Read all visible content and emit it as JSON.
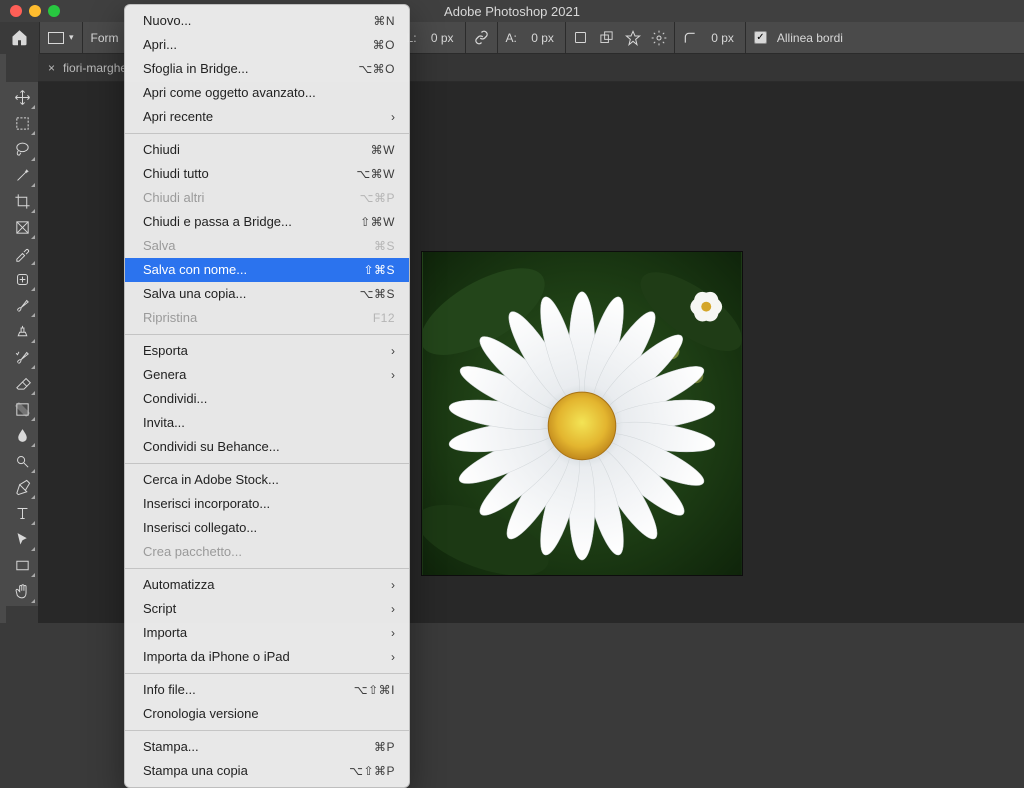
{
  "window": {
    "title": "Adobe Photoshop 2021"
  },
  "optionsbar": {
    "shape_tool": "rectangle",
    "form_label": "Form",
    "width_label": "L:",
    "width_value": "0 px",
    "height_label": "A:",
    "height_value": "0 px",
    "radius_value": "0 px",
    "align_edges_label": "Allinea bordi",
    "align_edges_checked": true
  },
  "tabs": {
    "document_tab": {
      "name": "fiori-marghe",
      "close_glyph": "×"
    }
  },
  "toolbar": {
    "tools": [
      "move-tool",
      "marquee-tool",
      "lasso-tool",
      "magic-wand-tool",
      "crop-tool",
      "frame-tool",
      "eyedropper-tool",
      "healing-brush-tool",
      "brush-tool",
      "clone-stamp-tool",
      "history-brush-tool",
      "eraser-tool",
      "gradient-tool",
      "blur-tool",
      "dodge-tool",
      "pen-tool",
      "type-tool",
      "path-selection-tool",
      "rectangle-shape-tool",
      "hand-tool"
    ]
  },
  "menu": {
    "groups": [
      [
        {
          "label": "Nuovo...",
          "shortcut": "⌘N",
          "enabled": true
        },
        {
          "label": "Apri...",
          "shortcut": "⌘O",
          "enabled": true
        },
        {
          "label": "Sfoglia in Bridge...",
          "shortcut": "⌥⌘O",
          "enabled": true
        },
        {
          "label": "Apri come oggetto avanzato...",
          "shortcut": "",
          "enabled": true
        },
        {
          "label": "Apri recente",
          "submenu": true,
          "enabled": true
        }
      ],
      [
        {
          "label": "Chiudi",
          "shortcut": "⌘W",
          "enabled": true
        },
        {
          "label": "Chiudi tutto",
          "shortcut": "⌥⌘W",
          "enabled": true
        },
        {
          "label": "Chiudi altri",
          "shortcut": "⌥⌘P",
          "enabled": false
        },
        {
          "label": "Chiudi e passa a Bridge...",
          "shortcut": "⇧⌘W",
          "enabled": true
        },
        {
          "label": "Salva",
          "shortcut": "⌘S",
          "enabled": false
        },
        {
          "label": "Salva con nome...",
          "shortcut": "⇧⌘S",
          "enabled": true,
          "highlight": true
        },
        {
          "label": "Salva una copia...",
          "shortcut": "⌥⌘S",
          "enabled": true
        },
        {
          "label": "Ripristina",
          "shortcut": "F12",
          "enabled": false
        }
      ],
      [
        {
          "label": "Esporta",
          "submenu": true,
          "enabled": true
        },
        {
          "label": "Genera",
          "submenu": true,
          "enabled": true
        },
        {
          "label": "Condividi...",
          "enabled": true
        },
        {
          "label": "Invita...",
          "enabled": true
        },
        {
          "label": "Condividi su Behance...",
          "enabled": true
        }
      ],
      [
        {
          "label": "Cerca in Adobe Stock...",
          "enabled": true
        },
        {
          "label": "Inserisci incorporato...",
          "enabled": true
        },
        {
          "label": "Inserisci collegato...",
          "enabled": true
        },
        {
          "label": "Crea pacchetto...",
          "enabled": false
        }
      ],
      [
        {
          "label": "Automatizza",
          "submenu": true,
          "enabled": true
        },
        {
          "label": "Script",
          "submenu": true,
          "enabled": true
        },
        {
          "label": "Importa",
          "submenu": true,
          "enabled": true
        },
        {
          "label": "Importa da iPhone o iPad",
          "submenu": true,
          "enabled": true
        }
      ],
      [
        {
          "label": "Info file...",
          "shortcut": "⌥⇧⌘I",
          "enabled": true
        },
        {
          "label": "Cronologia versione",
          "enabled": true
        }
      ],
      [
        {
          "label": "Stampa...",
          "shortcut": "⌘P",
          "enabled": true
        },
        {
          "label": "Stampa una copia",
          "shortcut": "⌥⇧⌘P",
          "enabled": true
        }
      ]
    ]
  },
  "image": {
    "subject": "daisy-flower"
  }
}
